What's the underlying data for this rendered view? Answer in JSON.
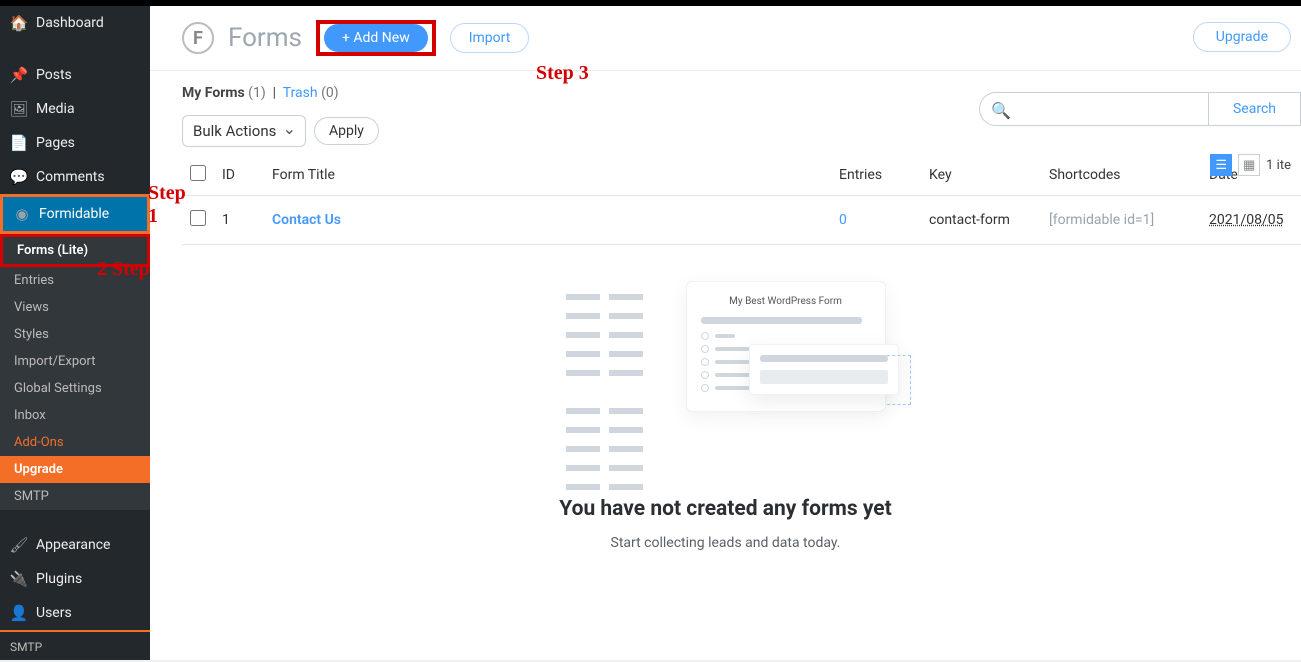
{
  "sidebar": {
    "items": [
      {
        "label": "Dashboard",
        "icon": "🏠"
      },
      {
        "label": "Posts",
        "icon": "📌"
      },
      {
        "label": "Media",
        "icon": "🖼"
      },
      {
        "label": "Pages",
        "icon": "📄"
      },
      {
        "label": "Comments",
        "icon": "💬"
      },
      {
        "label": "Formidable",
        "icon": "◉"
      }
    ],
    "submenu": [
      {
        "label": "Forms (Lite)"
      },
      {
        "label": "Entries"
      },
      {
        "label": "Views"
      },
      {
        "label": "Styles"
      },
      {
        "label": "Import/Export"
      },
      {
        "label": "Global Settings"
      },
      {
        "label": "Inbox"
      },
      {
        "label": "Add-Ons"
      },
      {
        "label": "Upgrade"
      },
      {
        "label": "SMTP"
      }
    ],
    "tail": [
      {
        "label": "Appearance",
        "icon": "🖌"
      },
      {
        "label": "Plugins",
        "icon": "🔌"
      },
      {
        "label": "Users",
        "icon": "👤"
      },
      {
        "label": "SMTP",
        "icon": ""
      }
    ]
  },
  "annotations": {
    "step1": "Step 1",
    "step2": "2  Step",
    "step3": "Step 3"
  },
  "header": {
    "title": "Forms",
    "addnew": "+ Add New",
    "import": "Import",
    "upgrade": "Upgrade"
  },
  "tabs": {
    "myforms": "My Forms",
    "myforms_count": "(1)",
    "sep": "|",
    "trash": "Trash",
    "trash_count": "(0)"
  },
  "toolbar": {
    "bulk": "Bulk Actions",
    "apply": "Apply"
  },
  "search": {
    "placeholder": "",
    "button": "Search"
  },
  "view": {
    "count": "1 ite"
  },
  "table": {
    "headers": {
      "id": "ID",
      "title": "Form Title",
      "entries": "Entries",
      "key": "Key",
      "shortcodes": "Shortcodes",
      "date": "Date"
    },
    "rows": [
      {
        "id": "1",
        "title": "Contact Us",
        "entries": "0",
        "key": "contact-form",
        "shortcode": "[formidable id=1]",
        "date": "2021/08/05"
      }
    ]
  },
  "empty": {
    "illus_title": "My Best WordPress Form",
    "heading": "You have not created any forms yet",
    "sub": "Start collecting leads and data today."
  }
}
